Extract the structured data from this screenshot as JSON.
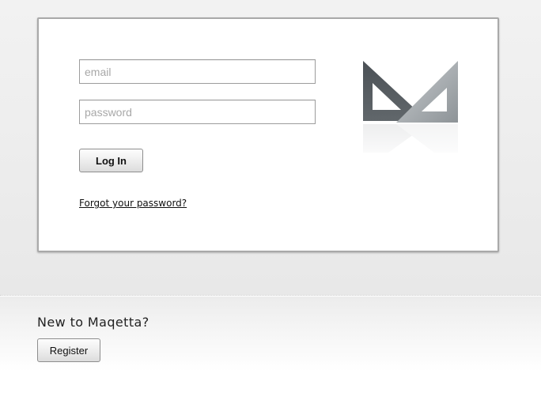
{
  "login": {
    "email_placeholder": "email",
    "password_placeholder": "password",
    "login_label": "Log In",
    "forgot_label": "Forgot your password?",
    "logo_icon": "maqetta-set-square-logo-icon"
  },
  "signup": {
    "heading": "New to Maqetta?",
    "register_label": "Register"
  },
  "colors": {
    "logo_dark": "#545a5f",
    "logo_light": "#9aa0a4",
    "card_border": "#a9a9a9"
  }
}
